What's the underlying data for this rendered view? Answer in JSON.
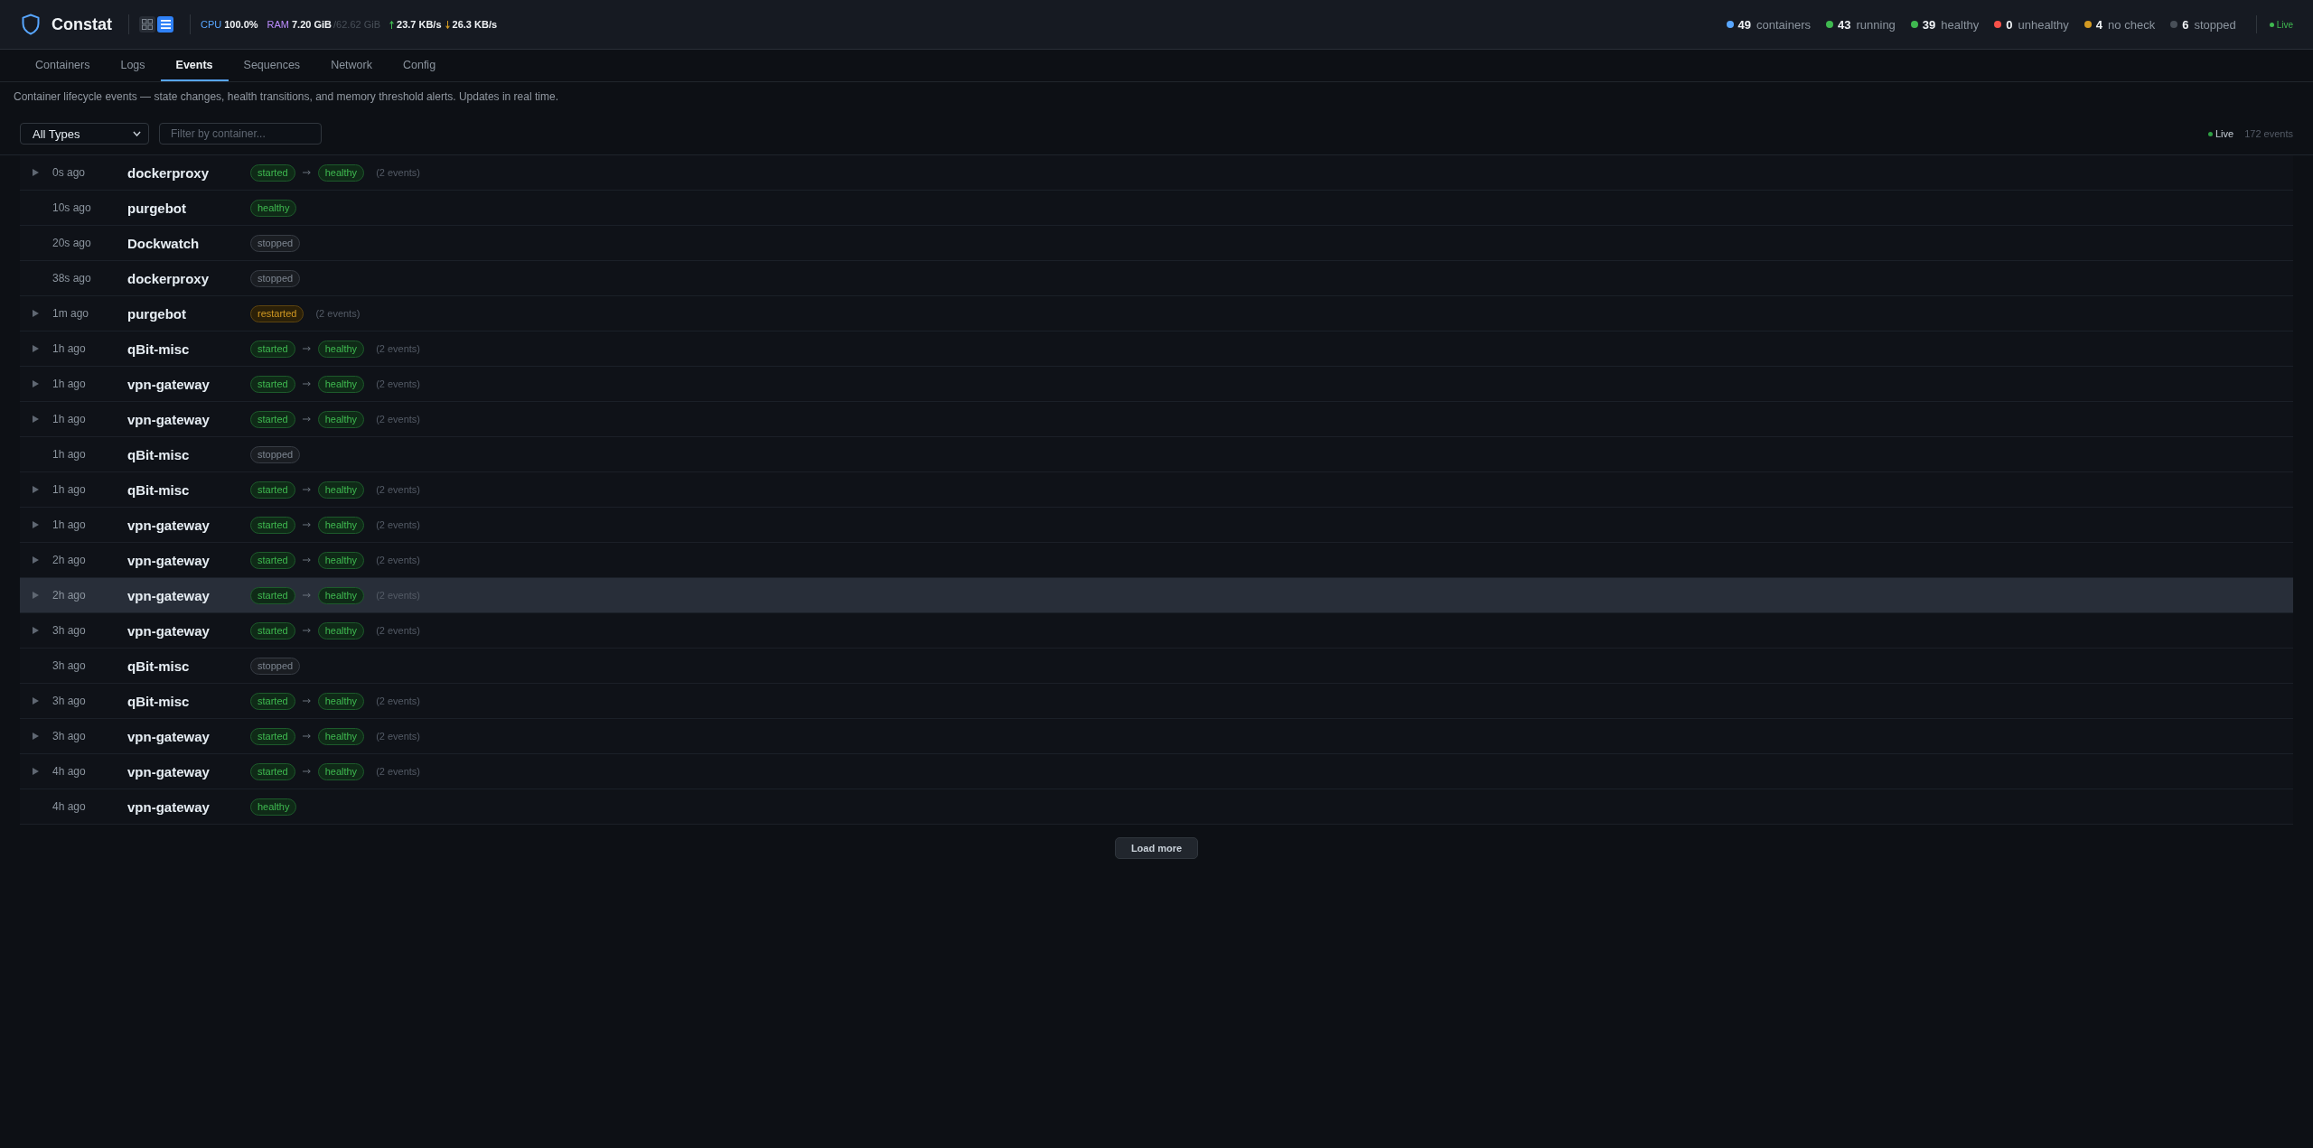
{
  "header": {
    "app_name": "Constat",
    "view_modes": [
      {
        "kind": "grid",
        "selected": false
      },
      {
        "kind": "list",
        "selected": true
      }
    ],
    "system": {
      "cpu": {
        "label": "CPU",
        "value": "100.0%"
      },
      "ram": {
        "label": "RAM",
        "value": "7.20 GiB",
        "total": "/62.62 GiB"
      },
      "network": {
        "upload": "23.7 KB/s",
        "download": "26.3 KB/s"
      }
    },
    "summary": [
      {
        "count": "49",
        "label": "containers",
        "color": "#58a6ff"
      },
      {
        "count": "43",
        "label": "running",
        "color": "#3fb950"
      },
      {
        "count": "39",
        "label": "healthy",
        "color": "#3fb950"
      },
      {
        "count": "0",
        "label": "unhealthy",
        "color": "#f85149"
      },
      {
        "count": "4",
        "label": "no check",
        "color": "#d29922"
      },
      {
        "count": "6",
        "label": "stopped",
        "color": "#484f58"
      }
    ],
    "live": {
      "label": "Live",
      "on": true
    }
  },
  "tabs": [
    {
      "label": "Containers",
      "selected": false
    },
    {
      "label": "Logs",
      "selected": false
    },
    {
      "label": "Events",
      "selected": true
    },
    {
      "label": "Sequences",
      "selected": false
    },
    {
      "label": "Network",
      "selected": false
    },
    {
      "label": "Config",
      "selected": false
    }
  ],
  "description": "Container lifecycle events — state changes, health transitions, and memory threshold alerts. Updates in real time.",
  "filters": {
    "type_select": {
      "value": "All Types"
    },
    "container_filter": {
      "placeholder": "Filter by container..."
    },
    "live": {
      "label": "Live",
      "on": true
    },
    "event_count": "172 events"
  },
  "events": [
    {
      "kind": "group",
      "expanded": false,
      "selected": false,
      "time": "0s ago",
      "container": "dockerproxy",
      "badges": [
        {
          "label": "started",
          "kind": "success"
        },
        {
          "label": "healthy",
          "kind": "success"
        }
      ],
      "count": "(2 events)"
    },
    {
      "kind": "single",
      "selected": false,
      "time": "10s ago",
      "container": "purgebot",
      "badges": [
        {
          "label": "healthy",
          "kind": "success"
        }
      ]
    },
    {
      "kind": "single",
      "selected": false,
      "time": "20s ago",
      "container": "Dockwatch",
      "badges": [
        {
          "label": "stopped",
          "kind": "neutral"
        }
      ]
    },
    {
      "kind": "single",
      "selected": false,
      "time": "38s ago",
      "container": "dockerproxy",
      "badges": [
        {
          "label": "stopped",
          "kind": "neutral"
        }
      ]
    },
    {
      "kind": "group",
      "expanded": false,
      "selected": false,
      "time": "1m ago",
      "container": "purgebot",
      "badges": [
        {
          "label": "restarted",
          "kind": "warning"
        }
      ],
      "count": "(2 events)"
    },
    {
      "kind": "group",
      "expanded": false,
      "selected": false,
      "time": "1h ago",
      "container": "qBit-misc",
      "badges": [
        {
          "label": "started",
          "kind": "success"
        },
        {
          "label": "healthy",
          "kind": "success"
        }
      ],
      "count": "(2 events)"
    },
    {
      "kind": "group",
      "expanded": false,
      "selected": false,
      "time": "1h ago",
      "container": "vpn-gateway",
      "badges": [
        {
          "label": "started",
          "kind": "success"
        },
        {
          "label": "healthy",
          "kind": "success"
        }
      ],
      "count": "(2 events)"
    },
    {
      "kind": "group",
      "expanded": false,
      "selected": false,
      "time": "1h ago",
      "container": "vpn-gateway",
      "badges": [
        {
          "label": "started",
          "kind": "success"
        },
        {
          "label": "healthy",
          "kind": "success"
        }
      ],
      "count": "(2 events)"
    },
    {
      "kind": "single",
      "selected": false,
      "time": "1h ago",
      "container": "qBit-misc",
      "badges": [
        {
          "label": "stopped",
          "kind": "neutral"
        }
      ]
    },
    {
      "kind": "group",
      "expanded": false,
      "selected": false,
      "time": "1h ago",
      "container": "qBit-misc",
      "badges": [
        {
          "label": "started",
          "kind": "success"
        },
        {
          "label": "healthy",
          "kind": "success"
        }
      ],
      "count": "(2 events)"
    },
    {
      "kind": "group",
      "expanded": false,
      "selected": false,
      "time": "1h ago",
      "container": "vpn-gateway",
      "badges": [
        {
          "label": "started",
          "kind": "success"
        },
        {
          "label": "healthy",
          "kind": "success"
        }
      ],
      "count": "(2 events)"
    },
    {
      "kind": "group",
      "expanded": false,
      "selected": false,
      "time": "2h ago",
      "container": "vpn-gateway",
      "badges": [
        {
          "label": "started",
          "kind": "success"
        },
        {
          "label": "healthy",
          "kind": "success"
        }
      ],
      "count": "(2 events)"
    },
    {
      "kind": "group",
      "expanded": false,
      "selected": true,
      "time": "2h ago",
      "container": "vpn-gateway",
      "badges": [
        {
          "label": "started",
          "kind": "success"
        },
        {
          "label": "healthy",
          "kind": "success"
        }
      ],
      "count": "(2 events)"
    },
    {
      "kind": "group",
      "expanded": false,
      "selected": false,
      "time": "3h ago",
      "container": "vpn-gateway",
      "badges": [
        {
          "label": "started",
          "kind": "success"
        },
        {
          "label": "healthy",
          "kind": "success"
        }
      ],
      "count": "(2 events)"
    },
    {
      "kind": "single",
      "selected": false,
      "time": "3h ago",
      "container": "qBit-misc",
      "badges": [
        {
          "label": "stopped",
          "kind": "neutral"
        }
      ]
    },
    {
      "kind": "group",
      "expanded": false,
      "selected": false,
      "time": "3h ago",
      "container": "qBit-misc",
      "badges": [
        {
          "label": "started",
          "kind": "success"
        },
        {
          "label": "healthy",
          "kind": "success"
        }
      ],
      "count": "(2 events)"
    },
    {
      "kind": "group",
      "expanded": false,
      "selected": false,
      "time": "3h ago",
      "container": "vpn-gateway",
      "badges": [
        {
          "label": "started",
          "kind": "success"
        },
        {
          "label": "healthy",
          "kind": "success"
        }
      ],
      "count": "(2 events)"
    },
    {
      "kind": "group",
      "expanded": false,
      "selected": false,
      "time": "4h ago",
      "container": "vpn-gateway",
      "badges": [
        {
          "label": "started",
          "kind": "success"
        },
        {
          "label": "healthy",
          "kind": "success"
        }
      ],
      "count": "(2 events)"
    },
    {
      "kind": "single",
      "selected": false,
      "time": "4h ago",
      "container": "vpn-gateway",
      "badges": [
        {
          "label": "healthy",
          "kind": "success"
        }
      ]
    }
  ],
  "load_more": "Load more"
}
